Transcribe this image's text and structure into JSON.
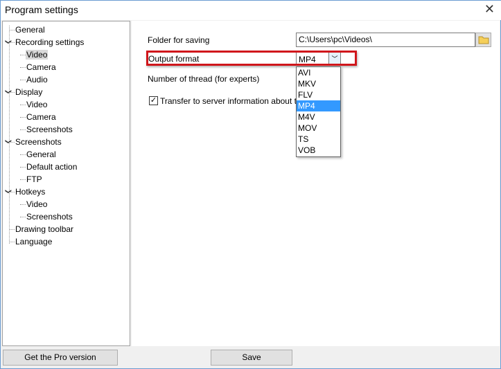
{
  "window": {
    "title": "Program settings",
    "close": "✕"
  },
  "tree": [
    {
      "label": "General",
      "level": 0,
      "chev": false
    },
    {
      "label": "Recording settings",
      "level": 0,
      "chev": true
    },
    {
      "label": "Video",
      "level": 1,
      "selected": true
    },
    {
      "label": "Camera",
      "level": 1
    },
    {
      "label": "Audio",
      "level": 1
    },
    {
      "label": "Display",
      "level": 0,
      "chev": true
    },
    {
      "label": "Video",
      "level": 1
    },
    {
      "label": "Camera",
      "level": 1
    },
    {
      "label": "Screenshots",
      "level": 1
    },
    {
      "label": "Screenshots",
      "level": 0,
      "chev": true
    },
    {
      "label": "General",
      "level": 1
    },
    {
      "label": "Default action",
      "level": 1
    },
    {
      "label": "FTP",
      "level": 1
    },
    {
      "label": "Hotkeys",
      "level": 0,
      "chev": true
    },
    {
      "label": "Video",
      "level": 1
    },
    {
      "label": "Screenshots",
      "level": 1
    },
    {
      "label": "Drawing toolbar",
      "level": 0
    },
    {
      "label": "Language",
      "level": 0
    }
  ],
  "settings": {
    "folder_label": "Folder for saving",
    "folder_value": "C:\\Users\\pc\\Videos\\",
    "format_label": "Output format",
    "format_value": "MP4",
    "threads_label": "Number of thread (for experts)",
    "transfer_label": "Transfer to server information about the video",
    "transfer_checked": true,
    "format_options": [
      "AVI",
      "MKV",
      "FLV",
      "MP4",
      "M4V",
      "MOV",
      "TS",
      "VOB"
    ],
    "highlight_color": "#d0161b"
  },
  "buttons": {
    "pro": "Get the Pro version",
    "save": "Save"
  }
}
